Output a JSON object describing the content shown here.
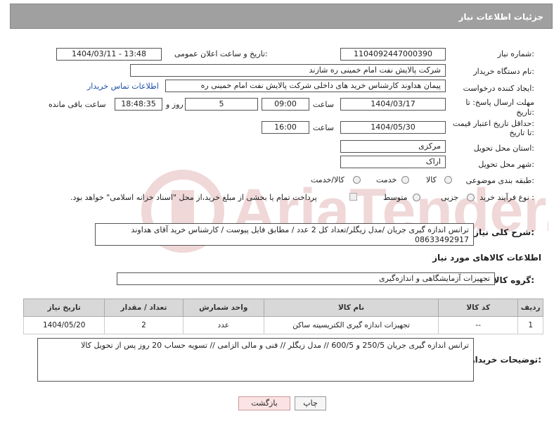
{
  "header": {
    "title": "جزئیات اطلاعات نیاز"
  },
  "fields": {
    "need_number_label": "شماره نیاز:",
    "need_number": "1104092447000390",
    "announce_label": "تاریخ و ساعت اعلان عمومی:",
    "announce_value": "1404/03/11 - 13:48",
    "buyer_org_label": "نام دستگاه خریدار:",
    "buyer_org": "شرکت پالایش نفت امام خمینی  ره  شازند",
    "creator_label": "ایجاد کننده درخواست:",
    "creator": "پیمان هداوند کارشناس خرید های داخلی  شرکت پالایش نفت امام خمینی  ره",
    "contact_link": "اطلاعات تماس خریدار",
    "deadline_label_1": "مهلت ارسال پاسخ: تا",
    "deadline_label_2": "تاریخ:",
    "deadline_date": "1404/03/17",
    "time_label": "ساعت",
    "deadline_time": "09:00",
    "days_value": "5",
    "days_label": "روز و",
    "remaining_time": "18:48:35",
    "remaining_label": "ساعت باقی مانده",
    "validity_label_1": "حداقل تاریخ اعتبار قیمت:",
    "validity_label_2": "تا تاریخ:",
    "validity_date": "1404/05/30",
    "validity_time": "16:00",
    "province_label": "استان محل تحویل:",
    "province": "مرکزی",
    "city_label": "شهر محل تحویل:",
    "city": "اراک",
    "category_label": "طبقه بندی موضوعی:",
    "category_options": [
      "کالا",
      "خدمت",
      "کالا/خدمت"
    ],
    "process_label": "نوع فرآیند خرید :",
    "process_options": [
      "جزیی",
      "متوسط"
    ],
    "payment_note": "پرداخت تمام یا بخشی از مبلغ خرید،از محل \"اسناد خزانه اسلامی\" خواهد بود.",
    "description_label": "شرح کلی نیاز:",
    "description_line1": "ترانس اندازه گیری جریان /مدل زیگلر/تعداد کل 2 عدد / مطابق فایل پیوست / کارشناس خرید آقای هداوند",
    "description_line2": "08633492917",
    "goods_info_title": "اطلاعات کالاهای مورد نیاز",
    "goods_group_label": "گروه کالا:",
    "goods_group": "تجهیزات آزمایشگاهی و اندازه‌گیری",
    "buyer_notes_label": "توضیحات خریدار:",
    "buyer_notes": "ترانس اندازه گیری جریان 250/5 و 600/5  //  مدل زیگلر //  فنی و مالی الزامی // تسویه حساب 20 روز پس از تحویل کالا"
  },
  "table": {
    "headers": [
      "ردیف",
      "کد کالا",
      "نام کالا",
      "واحد شمارش",
      "تعداد / مقدار",
      "تاریخ نیاز"
    ],
    "rows": [
      [
        "1",
        "--",
        "تجهیزات اندازه گیری الکتریسیته ساکن",
        "عدد",
        "2",
        "1404/05/20"
      ]
    ]
  },
  "buttons": {
    "print": "چاپ",
    "back": "بازگشت"
  },
  "watermark": {
    "text": "AriaTender.net"
  },
  "colors": {
    "header_bg": "#a0a0a0",
    "link": "#1a4fa8",
    "back_button": "#fbe3e3"
  }
}
